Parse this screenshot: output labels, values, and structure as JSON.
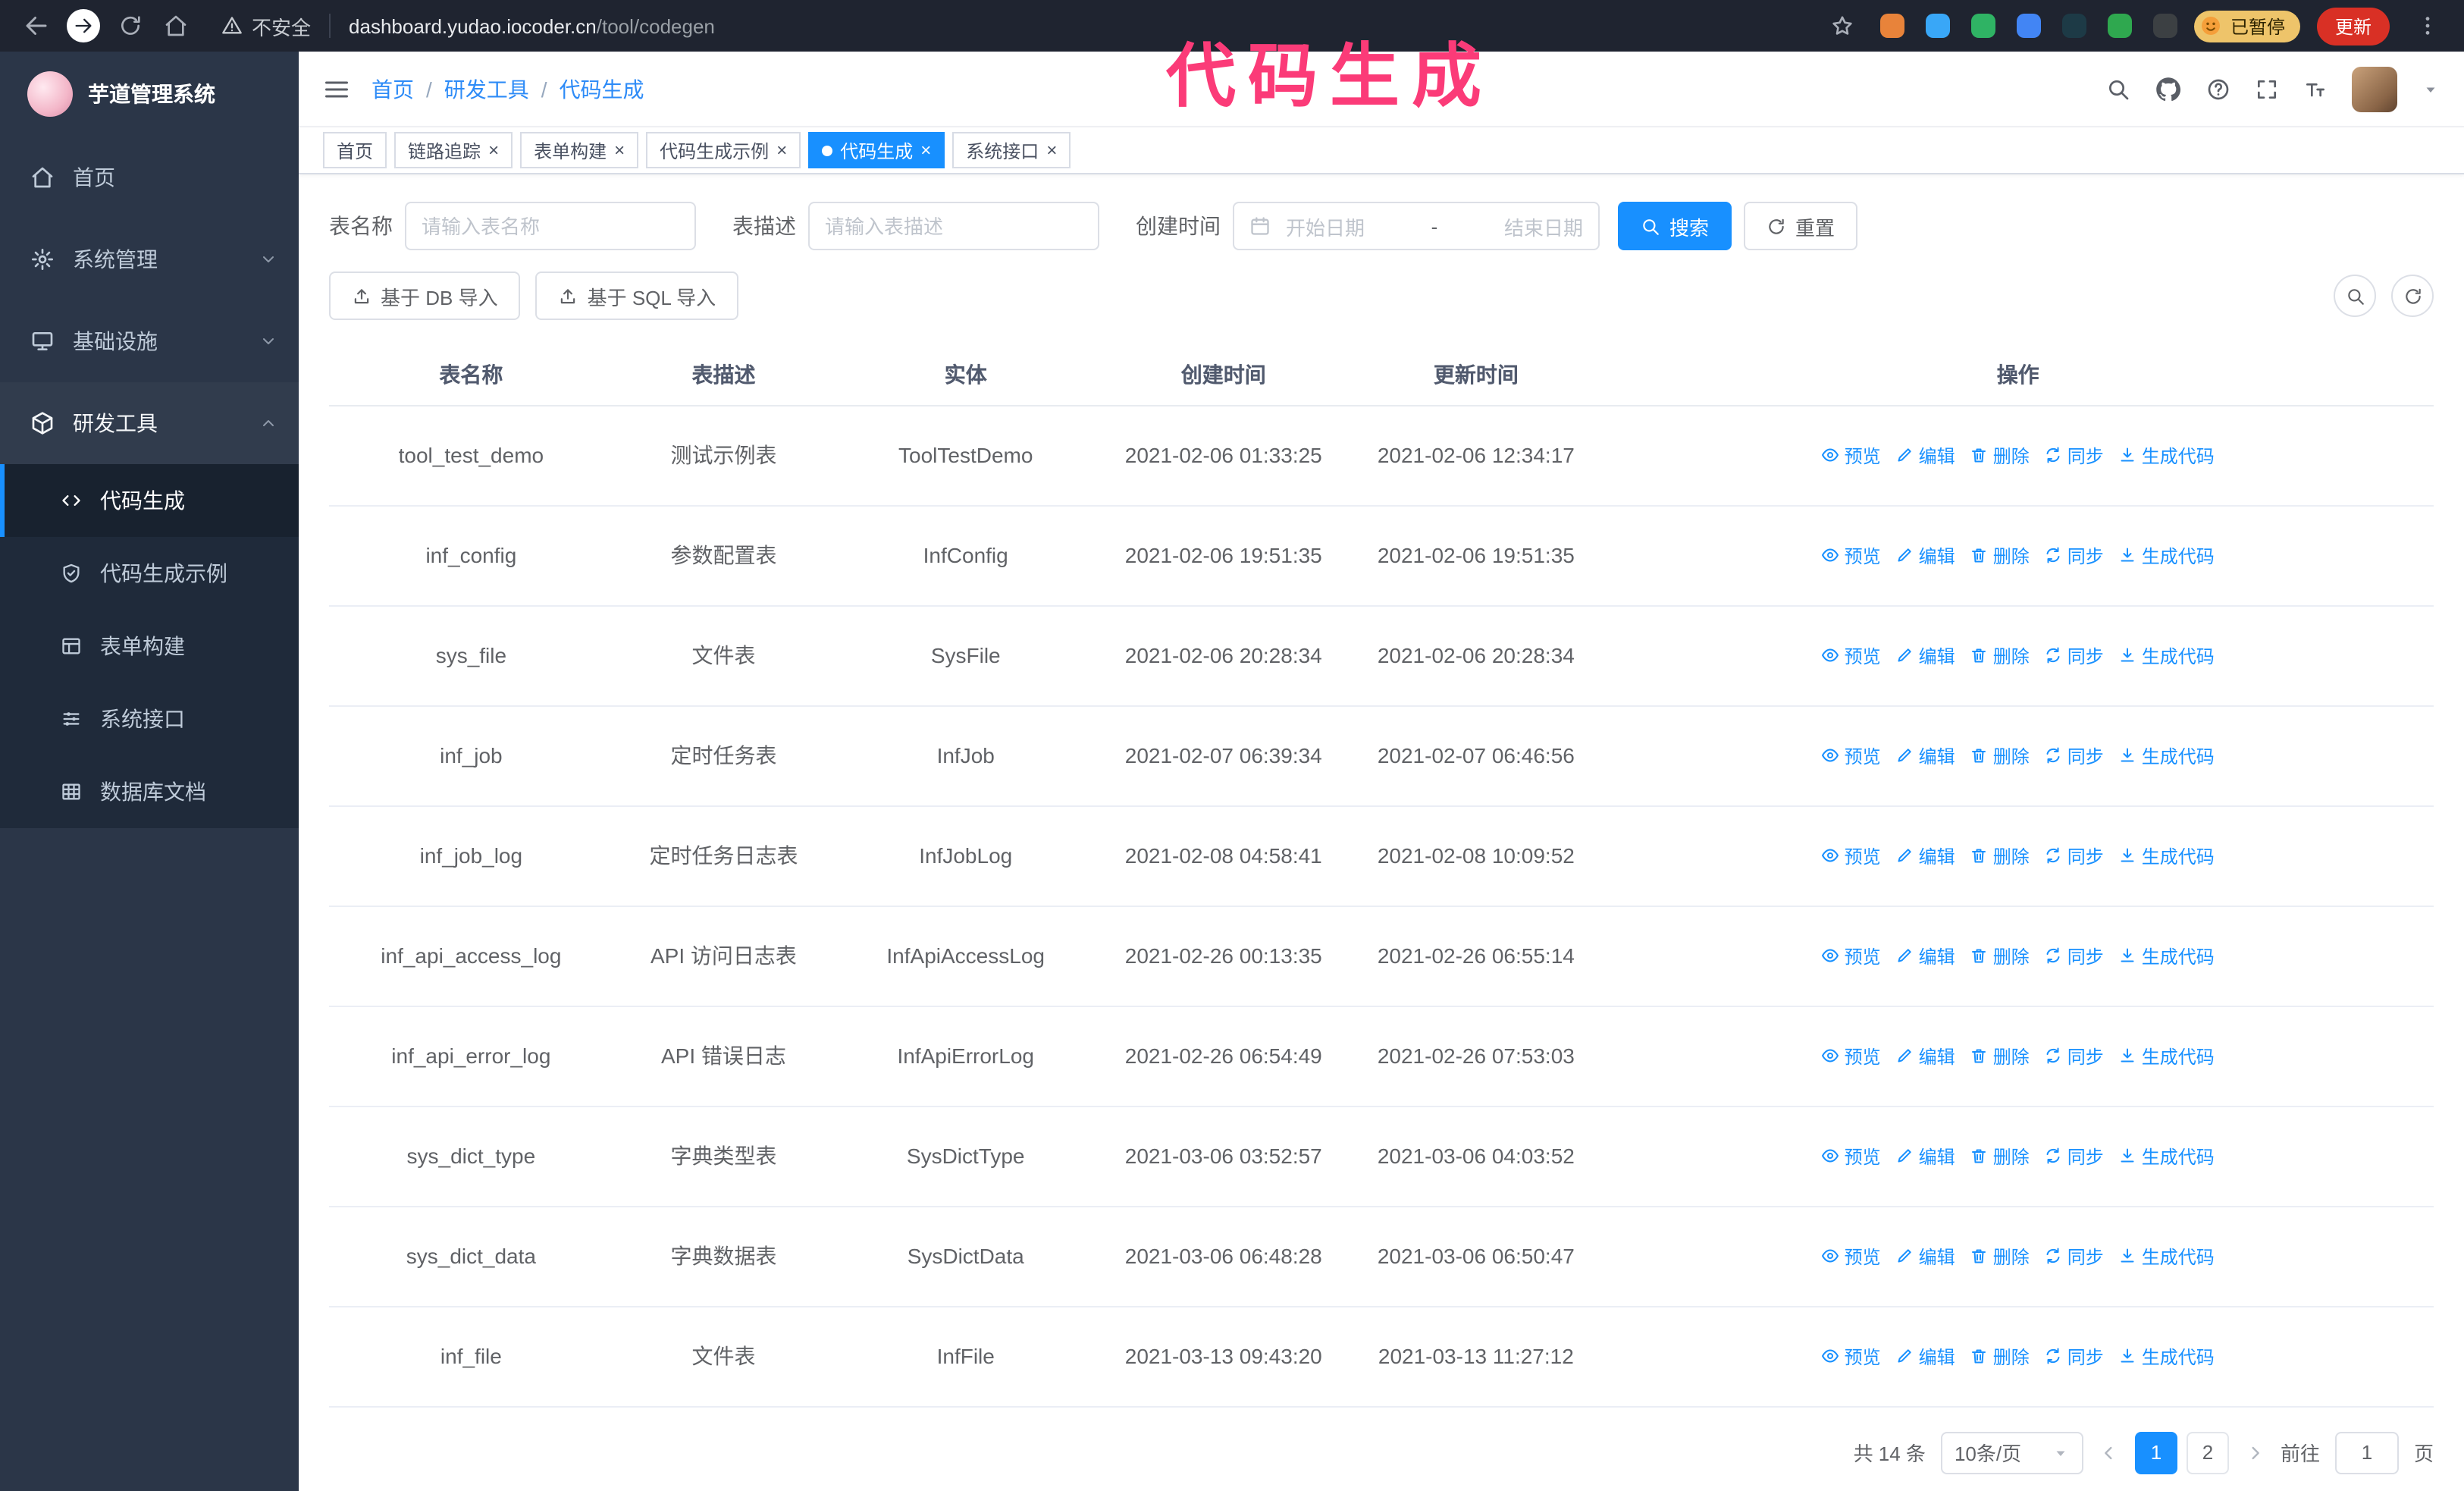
{
  "annotation": {
    "text": "代码生成",
    "color": "#fb3b78"
  },
  "browser": {
    "security_label": "不安全",
    "url_host": "dashboard.yudao.iocoder.cn",
    "url_path": "/tool/codegen",
    "paused_badge": "已暂停",
    "update_button": "更新",
    "extension_colors": [
      "#e8833a",
      "#39a7f7",
      "#2fb364",
      "#4285f4",
      "#1d3a46",
      "#2fa84f",
      "#3c4043"
    ]
  },
  "sidebar": {
    "app_title": "芋道管理系统",
    "menu": [
      {
        "key": "home",
        "label": "首页",
        "icon": "home-icon"
      },
      {
        "key": "system",
        "label": "系统管理",
        "icon": "gear-icon",
        "chevron": "down"
      },
      {
        "key": "infra",
        "label": "基础设施",
        "icon": "infra-icon",
        "chevron": "down"
      },
      {
        "key": "devtools",
        "label": "研发工具",
        "icon": "tools-icon",
        "chevron": "up",
        "expanded": true,
        "children": [
          {
            "key": "codegen",
            "label": "代码生成",
            "icon": "code-icon",
            "active": true
          },
          {
            "key": "codegen-example",
            "label": "代码生成示例",
            "icon": "shield-check-icon"
          },
          {
            "key": "form-builder",
            "label": "表单构建",
            "icon": "form-icon"
          },
          {
            "key": "api",
            "label": "系统接口",
            "icon": "sliders-icon"
          },
          {
            "key": "db-doc",
            "label": "数据库文档",
            "icon": "grid-doc-icon"
          }
        ]
      }
    ]
  },
  "header": {
    "breadcrumb": [
      "首页",
      "研发工具",
      "代码生成"
    ],
    "separator": "/"
  },
  "tabs": [
    {
      "key": "home",
      "label": "首页",
      "closable": false
    },
    {
      "key": "tracer",
      "label": "链路追踪",
      "closable": true
    },
    {
      "key": "form-builder",
      "label": "表单构建",
      "closable": true
    },
    {
      "key": "codegen-example",
      "label": "代码生成示例",
      "closable": true
    },
    {
      "key": "codegen",
      "label": "代码生成",
      "closable": true,
      "active": true
    },
    {
      "key": "api",
      "label": "系统接口",
      "closable": true
    }
  ],
  "filters": {
    "table_name_label": "表名称",
    "table_name_placeholder": "请输入表名称",
    "table_desc_label": "表描述",
    "table_desc_placeholder": "请输入表描述",
    "create_time_label": "创建时间",
    "start_date_placeholder": "开始日期",
    "end_date_placeholder": "结束日期",
    "range_separator": "-",
    "search_button": "搜索",
    "reset_button": "重置"
  },
  "toolbar": {
    "import_db_button": "基于 DB 导入",
    "import_sql_button": "基于 SQL 导入"
  },
  "table": {
    "columns": [
      "表名称",
      "表描述",
      "实体",
      "创建时间",
      "更新时间",
      "操作"
    ],
    "actions": [
      {
        "key": "preview",
        "label": "预览",
        "icon": "eye-icon"
      },
      {
        "key": "edit",
        "label": "编辑",
        "icon": "edit-icon"
      },
      {
        "key": "delete",
        "label": "删除",
        "icon": "delete-icon"
      },
      {
        "key": "sync",
        "label": "同步",
        "icon": "sync-icon"
      },
      {
        "key": "generate",
        "label": "生成代码",
        "icon": "download-icon"
      }
    ],
    "rows": [
      {
        "name": "tool_test_demo",
        "desc": "测试示例表",
        "entity": "ToolTestDemo",
        "created": "2021-02-06 01:33:25",
        "updated": "2021-02-06 12:34:17"
      },
      {
        "name": "inf_config",
        "desc": "参数配置表",
        "entity": "InfConfig",
        "created": "2021-02-06 19:51:35",
        "updated": "2021-02-06 19:51:35"
      },
      {
        "name": "sys_file",
        "desc": "文件表",
        "entity": "SysFile",
        "created": "2021-02-06 20:28:34",
        "updated": "2021-02-06 20:28:34"
      },
      {
        "name": "inf_job",
        "desc": "定时任务表",
        "entity": "InfJob",
        "created": "2021-02-07 06:39:34",
        "updated": "2021-02-07 06:46:56"
      },
      {
        "name": "inf_job_log",
        "desc": "定时任务日志表",
        "entity": "InfJobLog",
        "created": "2021-02-08 04:58:41",
        "updated": "2021-02-08 10:09:52"
      },
      {
        "name": "inf_api_access_log",
        "desc": "API 访问日志表",
        "entity": "InfApiAccessLog",
        "created": "2021-02-26 00:13:35",
        "updated": "2021-02-26 06:55:14"
      },
      {
        "name": "inf_api_error_log",
        "desc": "API 错误日志",
        "entity": "InfApiErrorLog",
        "created": "2021-02-26 06:54:49",
        "updated": "2021-02-26 07:53:03"
      },
      {
        "name": "sys_dict_type",
        "desc": "字典类型表",
        "entity": "SysDictType",
        "created": "2021-03-06 03:52:57",
        "updated": "2021-03-06 04:03:52"
      },
      {
        "name": "sys_dict_data",
        "desc": "字典数据表",
        "entity": "SysDictData",
        "created": "2021-03-06 06:48:28",
        "updated": "2021-03-06 06:50:47"
      },
      {
        "name": "inf_file",
        "desc": "文件表",
        "entity": "InfFile",
        "created": "2021-03-13 09:43:20",
        "updated": "2021-03-13 11:27:12"
      }
    ]
  },
  "pagination": {
    "total": "共 14 条",
    "page_size": "10条/页",
    "pages": [
      "1",
      "2"
    ],
    "active_page": "1",
    "goto_label": "前往",
    "goto_value": "1",
    "page_suffix": "页"
  },
  "ui": {
    "close_glyph": "×"
  },
  "colors": {
    "accent": "#1890ff",
    "update_button_red": "#d93025",
    "paused_badge_bg": "#eec46a",
    "sidebar_bg": "#2b3648"
  }
}
